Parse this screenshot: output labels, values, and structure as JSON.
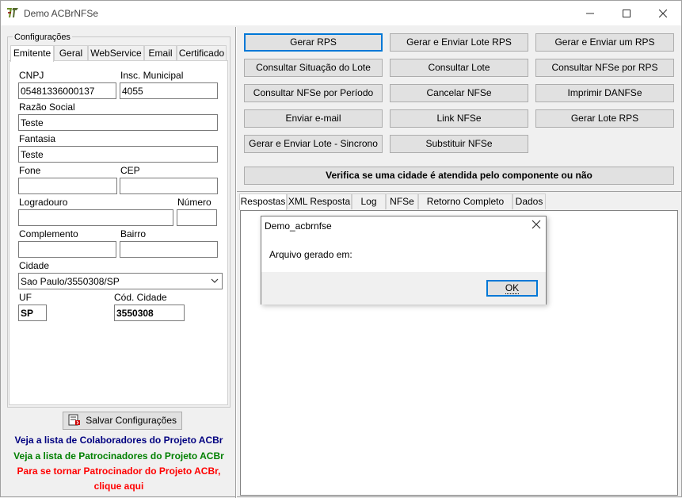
{
  "window": {
    "title": "Demo ACBrNFSe"
  },
  "config": {
    "legend": "Configurações",
    "tabs": [
      "Emitente",
      "Geral",
      "WebService",
      "Email",
      "Certificado"
    ],
    "fields": {
      "cnpj_label": "CNPJ",
      "cnpj_value": "05481336000137",
      "insc_label": "Insc. Municipal",
      "insc_value": "4055",
      "razao_label": "Razão Social",
      "razao_value": "Teste",
      "fantasia_label": "Fantasia",
      "fantasia_value": "Teste",
      "fone_label": "Fone",
      "fone_value": "",
      "cep_label": "CEP",
      "cep_value": "",
      "logradouro_label": "Logradouro",
      "logradouro_value": "",
      "numero_label": "Número",
      "numero_value": "",
      "complemento_label": "Complemento",
      "complemento_value": "",
      "bairro_label": "Bairro",
      "bairro_value": "",
      "cidade_label": "Cidade",
      "cidade_value": "Sao Paulo/3550308/SP",
      "uf_label": "UF",
      "uf_value": "SP",
      "cod_label": "Cód. Cidade",
      "cod_value": "3550308"
    },
    "save_label": "Salvar Configurações"
  },
  "links": {
    "colaboradores": "Veja a lista de Colaboradores do Projeto ACBr",
    "patrocinadores": "Veja a lista de Patrocinadores do Projeto ACBr",
    "tornar1": "Para se tornar Patrocinador do Projeto ACBr,",
    "tornar2": "clique aqui",
    "color_colab": "#000080",
    "color_patro": "#008000",
    "color_tornar": "#ff0000"
  },
  "actions": {
    "gerar_rps": "Gerar RPS",
    "gerar_enviar_lote": "Gerar e Enviar Lote RPS",
    "gerar_enviar_um": "Gerar e Enviar um RPS",
    "consultar_situacao": "Consultar Situação do Lote",
    "consultar_lote": "Consultar Lote",
    "consultar_nfse_rps": "Consultar NFSe por RPS",
    "consultar_periodo": "Consultar NFSe por Período",
    "cancelar": "Cancelar NFSe",
    "imprimir": "Imprimir DANFSe",
    "enviar_email": "Enviar e-mail",
    "link_nfse": "Link NFSe",
    "gerar_lote": "Gerar Lote RPS",
    "gerar_enviar_sincrono": "Gerar e Enviar Lote - Sincrono",
    "substituir": "Substituir NFSe",
    "verifica": "Verifica se uma cidade é atendida pelo componente ou não"
  },
  "response_tabs": [
    "Respostas",
    "XML Resposta",
    "Log",
    "NFSe",
    "Retorno Completo WS",
    "Dados"
  ],
  "dialog": {
    "title": "Demo_acbrnfse",
    "message": "Arquivo gerado em:",
    "ok_label": "OK"
  }
}
